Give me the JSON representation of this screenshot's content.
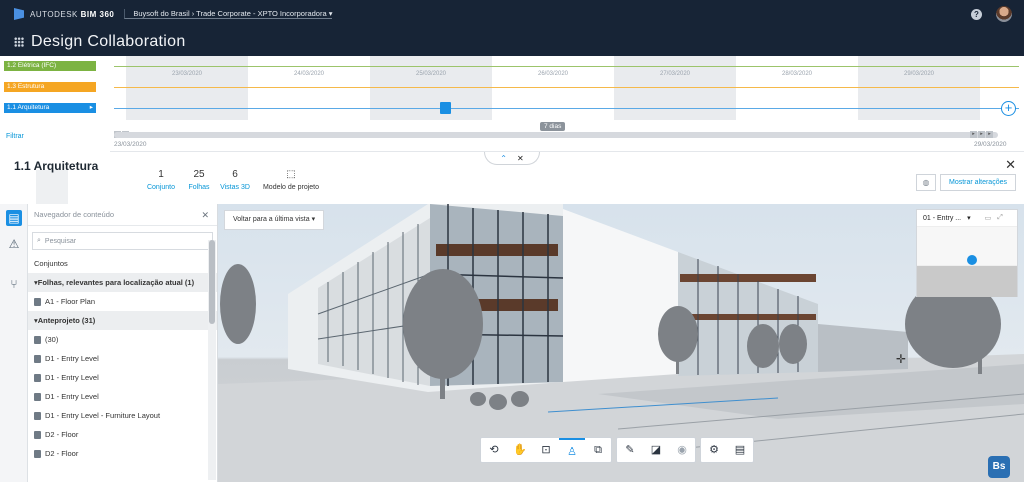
{
  "header": {
    "brand_prefix": "AUTODESK",
    "brand_product": "BIM 360",
    "project_path": "Buysoft do Brasil › Trade Corporate - XPTO Incorporadora ▾",
    "help_icon": "help-icon"
  },
  "app": {
    "title": "Design Collaboration"
  },
  "timeline": {
    "tracks": [
      {
        "label": "1.2 Elétrica (IFC)",
        "color": "#7cb342"
      },
      {
        "label": "1.3 Estrutura",
        "color": "#f5a623"
      },
      {
        "label": "1.1 Arquitetura",
        "color": "#1a8fe3"
      }
    ],
    "filter_label": "Filtrar",
    "days": [
      "23/03/2020",
      "24/03/2020",
      "25/03/2020",
      "26/03/2020",
      "27/03/2020",
      "28/03/2020",
      "29/03/2020"
    ],
    "range_label": "7 dias",
    "start": "23/03/2020",
    "end": "29/03/2020"
  },
  "package": {
    "title": "1.1 Arquitetura",
    "stats": [
      {
        "count": "1",
        "label": "Conjunto"
      },
      {
        "count": "25",
        "label": "Folhas"
      },
      {
        "count": "6",
        "label": "Vistas 3D"
      },
      {
        "count": "",
        "label": "Modelo de projeto"
      }
    ],
    "show_changes": "Mostrar alterações"
  },
  "navigator": {
    "title": "Navegador de conteúdo",
    "search_placeholder": "Pesquisar",
    "rows": [
      {
        "text": "Conjuntos",
        "type": "plain"
      },
      {
        "text": "▾Folhas, relevantes para localização atual (1)",
        "type": "sect"
      },
      {
        "text": "A1 - Floor Plan",
        "type": "doc"
      },
      {
        "text": "▾Anteprojeto (31)",
        "type": "sect"
      },
      {
        "text": "(30)",
        "type": "doc"
      },
      {
        "text": "D1 - Entry Level",
        "type": "doc"
      },
      {
        "text": "D1 - Entry Level",
        "type": "doc"
      },
      {
        "text": "D1 - Entry Level",
        "type": "doc"
      },
      {
        "text": "D1 - Entry Level - Furniture Layout",
        "type": "doc"
      },
      {
        "text": "D2 - Floor",
        "type": "doc"
      },
      {
        "text": "D2 - Floor",
        "type": "doc"
      }
    ]
  },
  "viewer": {
    "back_button": "Voltar para a última vista",
    "minimap_label": "01 - Entry ...",
    "badge": "Bs"
  }
}
